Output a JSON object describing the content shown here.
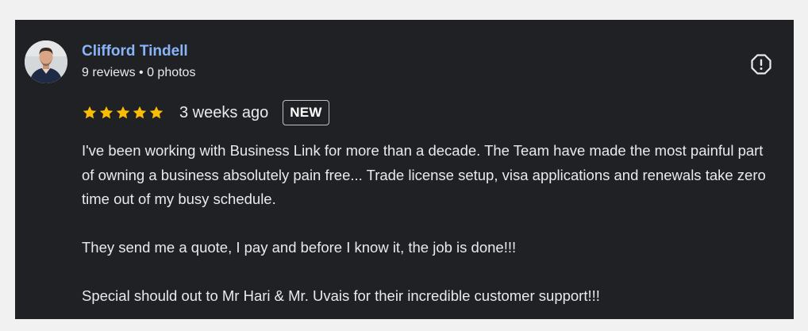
{
  "review": {
    "reviewer": {
      "name": "Clifford Tindell",
      "meta": "9 reviews • 0 photos"
    },
    "rating": 5,
    "rating_max": 5,
    "time": "3 weeks ago",
    "badge": "NEW",
    "paragraphs": [
      "I've been working with Business Link for more than a decade. The Team have made the most painful part of owning a business absolutely pain free... Trade license setup, visa applications and renewals take zero time out of my busy schedule.",
      "They send me a quote, I pay and before I know it, the job is done!!!",
      "Special should out to Mr Hari & Mr. Uvais for their incredible customer support!!!"
    ]
  },
  "icons": {
    "report": "report-icon",
    "star": "star-icon"
  },
  "colors": {
    "card_background": "#202124",
    "page_background": "#f1f1f1",
    "name_link": "#8ab4f8",
    "star": "#fbbc04",
    "text": "#e8eaed"
  }
}
